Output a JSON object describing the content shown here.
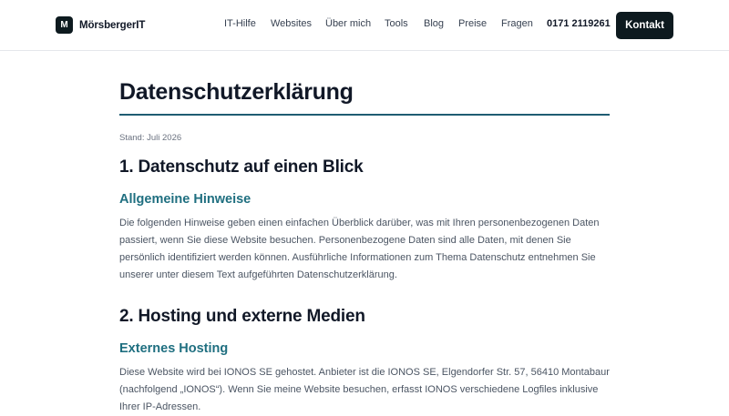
{
  "header": {
    "logo_letter": "M",
    "logo_text": "MörsbergerIT",
    "nav": [
      "IT-Hilfe",
      "Websites",
      "Über mich",
      "Tools",
      "Blog",
      "Preise",
      "Fragen"
    ],
    "phone": "0171 2119261",
    "cta_label": "Kontakt"
  },
  "page": {
    "title": "Datenschutzerklärung",
    "stand": "Stand: Juli 2026"
  },
  "sections": [
    {
      "heading": "1. Datenschutz auf einen Blick",
      "subheading": "Allgemeine Hinweise",
      "text": "Die folgenden Hinweise geben einen einfachen Überblick darüber, was mit Ihren personenbezogenen Daten passiert, wenn Sie diese Website besuchen. Personenbezogene Daten sind alle Daten, mit denen Sie persönlich identifiziert werden können. Ausführliche Informationen zum Thema Datenschutz entnehmen Sie unserer unter diesem Text aufgeführten Datenschutzerklärung."
    },
    {
      "heading": "2. Hosting und externe Medien",
      "subheading": "Externes Hosting",
      "text": "Diese Website wird bei IONOS SE gehostet. Anbieter ist die IONOS SE, Elgendorfer Str. 57, 56410 Montabaur (nachfolgend „IONOS“). Wenn Sie meine Website besuchen, erfasst IONOS verschiedene Logfiles inklusive Ihrer IP-Adressen."
    }
  ]
}
